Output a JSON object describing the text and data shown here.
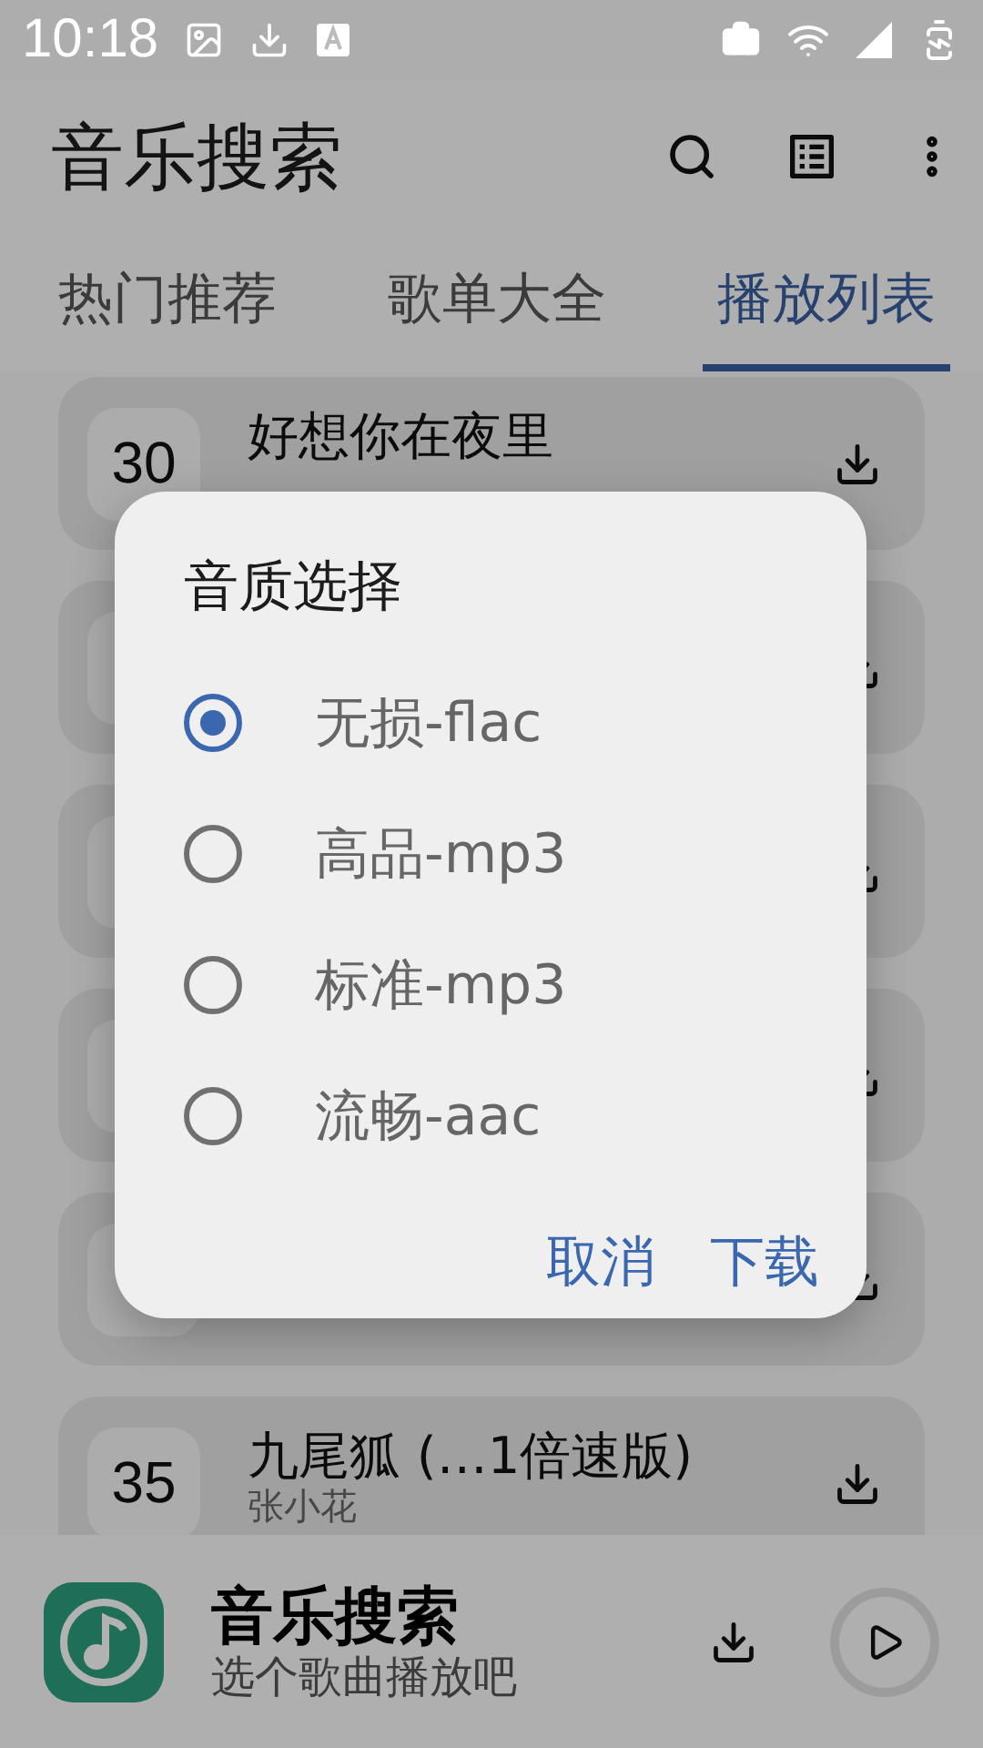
{
  "status_bar": {
    "time": "10:18"
  },
  "app_bar": {
    "title": "音乐搜索"
  },
  "tabs": [
    {
      "label": "热门推荐",
      "selected": false
    },
    {
      "label": "歌单大全",
      "selected": false
    },
    {
      "label": "播放列表",
      "selected": true
    }
  ],
  "songs": [
    {
      "kind": "song",
      "number": "30",
      "title": "好想你在夜里"
    },
    {
      "kind": "covered"
    },
    {
      "kind": "covered"
    },
    {
      "kind": "covered"
    },
    {
      "kind": "covered"
    },
    {
      "kind": "song",
      "number": "35",
      "title": "九尾狐 (…1倍速版)",
      "artist": "张小花"
    }
  ],
  "dialog": {
    "title": "音质选择",
    "options": [
      {
        "label": "无损-flac",
        "selected": true
      },
      {
        "label": "高品-mp3",
        "selected": false
      },
      {
        "label": "标准-mp3",
        "selected": false
      },
      {
        "label": "流畅-aac",
        "selected": false
      }
    ],
    "buttons": [
      "取消",
      "下载"
    ]
  },
  "player": {
    "title": "音乐搜索",
    "subtitle": "选个歌曲播放吧"
  }
}
